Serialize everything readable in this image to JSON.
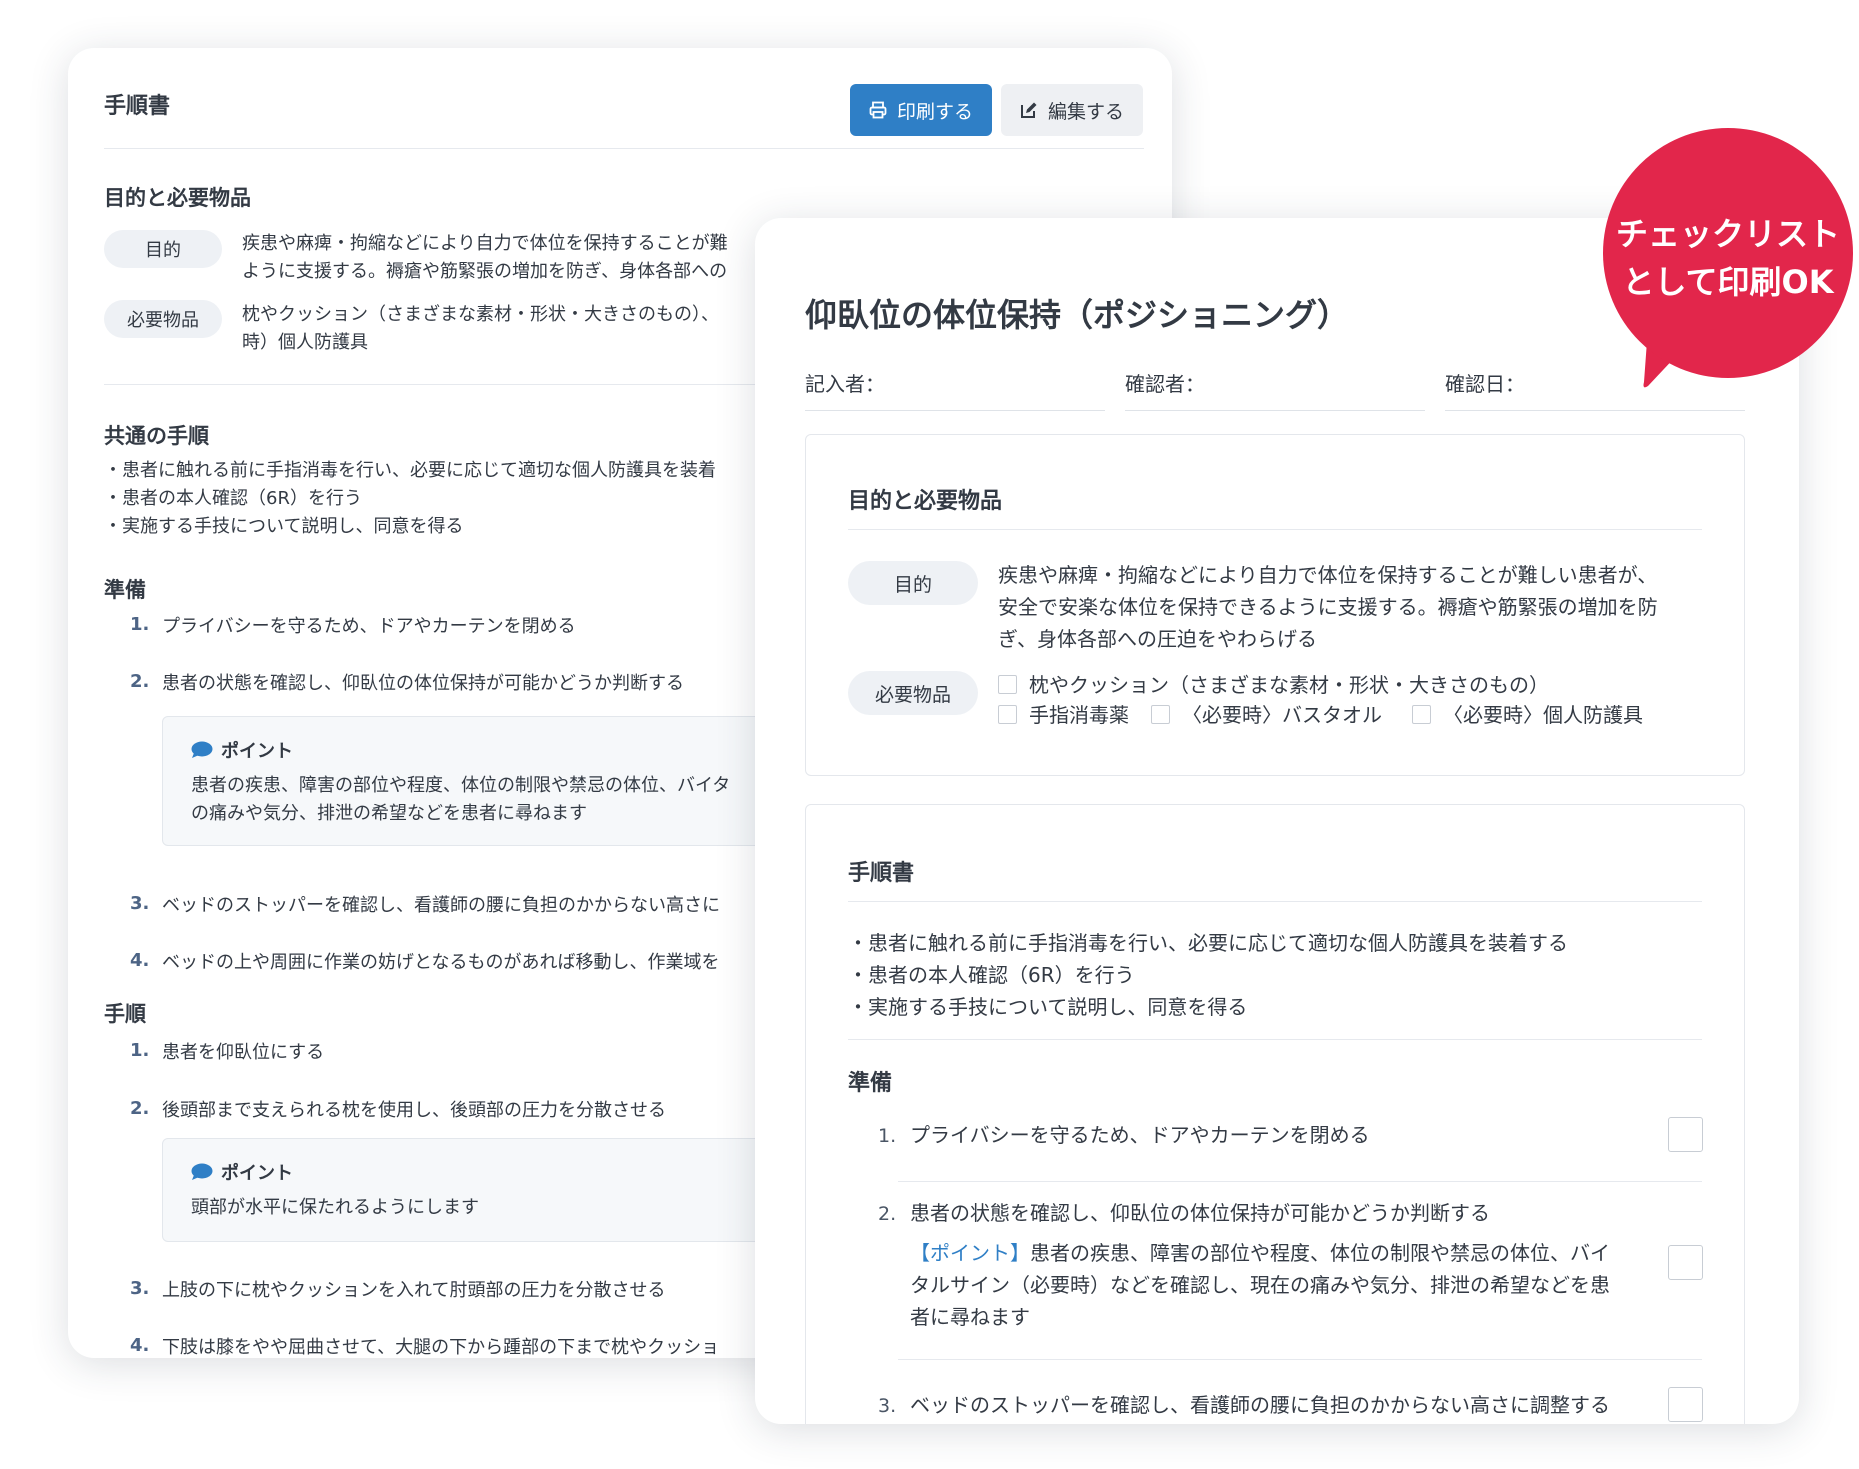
{
  "back": {
    "title": "手順書",
    "print_button": "印刷する",
    "edit_button": "編集する",
    "purpose_section": {
      "heading": "目的と必要物品",
      "purpose_label": "目的",
      "purpose_line1": "疾患や麻痺・拘縮などにより自力で体位を保持することが難",
      "purpose_line2": "ように支援する。褥瘡や筋緊張の増加を防ぎ、身体各部への",
      "items_label": "必要物品",
      "items_line1": "枕やクッション（さまざまな素材・形状・大きさのもの）、",
      "items_line2": "時）個人防護具"
    },
    "common": {
      "heading": "共通の手順",
      "lines": [
        "・患者に触れる前に手指消毒を行い、必要に応じて適切な個人防護具を装着",
        "・患者の本人確認（6R）を行う",
        "・実施する手技について説明し、同意を得る"
      ]
    },
    "prep": {
      "heading": "準備",
      "steps": [
        {
          "num": "1.",
          "text": "プライバシーを守るため、ドアやカーテンを閉める"
        },
        {
          "num": "2.",
          "text": "患者の状態を確認し、仰臥位の体位保持が可能かどうか判断する"
        },
        {
          "num": "3.",
          "text": "ベッドのストッパーを確認し、看護師の腰に負担のかからない高さに"
        },
        {
          "num": "4.",
          "text": "ベッドの上や周囲に作業の妨げとなるものがあれば移動し、作業域を"
        }
      ],
      "point_title": "ポイント",
      "point_line1": "患者の疾患、障害の部位や程度、体位の制限や禁忌の体位、バイタ",
      "point_line2": "の痛みや気分、排泄の希望などを患者に尋ねます"
    },
    "proc": {
      "heading": "手順",
      "steps": [
        {
          "num": "1.",
          "text": "患者を仰臥位にする"
        },
        {
          "num": "2.",
          "text": "後頭部まで支えられる枕を使用し、後頭部の圧力を分散させる"
        },
        {
          "num": "3.",
          "text": "上肢の下に枕やクッションを入れて肘頭部の圧力を分散させる"
        },
        {
          "num": "4.",
          "text": "下肢は膝をやや屈曲させて、大腿の下から踵部の下まで枕やクッショ"
        }
      ],
      "point_title": "ポイント",
      "point_text": "頭部が水平に保たれるようにします"
    }
  },
  "front": {
    "title": "仰臥位の体位保持（ポジショニング）",
    "recorder_label": "記入者：",
    "checker_label": "確認者：",
    "date_label": "確認日：",
    "purpose_section": {
      "heading": "目的と必要物品",
      "purpose_label": "目的",
      "purpose_lines": [
        "疾患や麻痺・拘縮などにより自力で体位を保持することが難しい患者が、",
        "安全で安楽な体位を保持できるように支援する。褥瘡や筋緊張の増加を防",
        "ぎ、身体各部への圧迫をやわらげる"
      ],
      "items_label": "必要物品",
      "items": [
        "枕やクッション（さまざまな素材・形状・大きさのもの）",
        "手指消毒薬",
        "〈必要時〉バスタオル",
        "〈必要時〉個人防護具"
      ]
    },
    "procedure": {
      "heading": "手順書",
      "lines": [
        "・患者に触れる前に手指消毒を行い、必要に応じて適切な個人防護具を装着する",
        "・患者の本人確認（6R）を行う",
        "・実施する手技について説明し、同意を得る"
      ],
      "prep_heading": "準備",
      "steps": [
        {
          "num": "1.",
          "text": "プライバシーを守るため、ドアやカーテンを閉める"
        },
        {
          "num": "2.",
          "text": "患者の状態を確認し、仰臥位の体位保持が可能かどうか判断する"
        },
        {
          "num": "3.",
          "text": "ベッドのストッパーを確認し、看護師の腰に負担のかからない高さに調整する"
        }
      ],
      "point_tag": "【ポイント】",
      "point_line1": "患者の疾患、障害の部位や程度、体位の制限や禁忌の体位、バイ",
      "point_line2": "タルサイン（必要時）などを確認し、現在の痛みや気分、排泄の希望などを患",
      "point_line3": "者に尋ねます"
    }
  },
  "badge": {
    "line1": "チェックリスト",
    "line2": "として印刷OK",
    "color": "#e2264b"
  },
  "colors": {
    "primary": "#2f7fc6",
    "badge": "#e2264b"
  }
}
